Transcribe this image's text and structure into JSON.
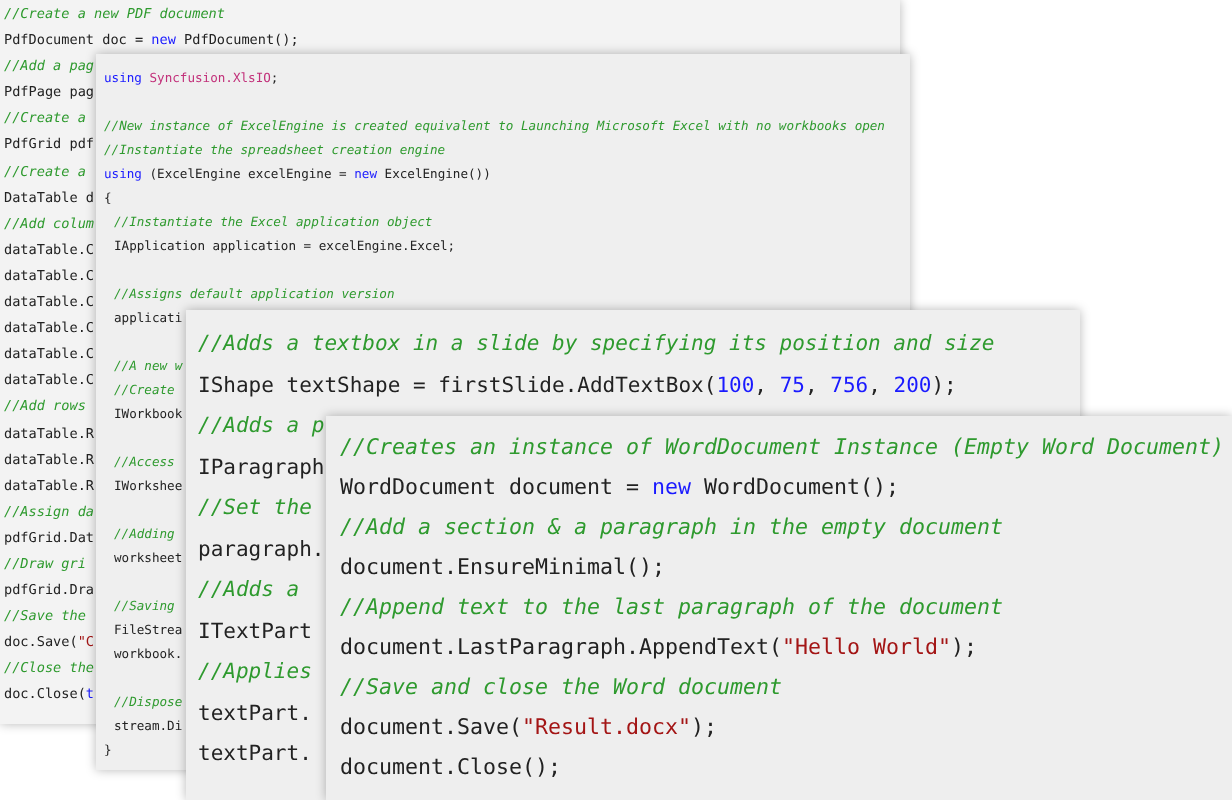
{
  "panels": [
    {
      "lines": [
        {
          "tokens": [
            {
              "text": "//Create a new PDF document",
              "kind": "comment"
            }
          ]
        },
        {
          "tokens": [
            {
              "text": "PdfDocument doc = ",
              "kind": "plain"
            },
            {
              "text": "new",
              "kind": "keyword"
            },
            {
              "text": " PdfDocument();",
              "kind": "plain"
            }
          ]
        },
        {
          "tokens": [
            {
              "text": "//Add a pag",
              "kind": "comment"
            }
          ]
        },
        {
          "tokens": [
            {
              "text": "PdfPage pag",
              "kind": "plain"
            }
          ]
        },
        {
          "tokens": [
            {
              "text": "//Create a",
              "kind": "comment"
            }
          ]
        },
        {
          "tokens": [
            {
              "text": "PdfGrid pdf",
              "kind": "plain"
            }
          ]
        },
        {
          "tokens": [
            {
              "text": "//Create a",
              "kind": "comment"
            }
          ]
        },
        {
          "tokens": [
            {
              "text": "DataTable d",
              "kind": "plain"
            }
          ]
        },
        {
          "tokens": [
            {
              "text": "//Add colum",
              "kind": "comment"
            }
          ]
        },
        {
          "tokens": [
            {
              "text": "dataTable.C",
              "kind": "plain"
            }
          ]
        },
        {
          "tokens": [
            {
              "text": "dataTable.C",
              "kind": "plain"
            }
          ]
        },
        {
          "tokens": [
            {
              "text": "dataTable.C",
              "kind": "plain"
            }
          ]
        },
        {
          "tokens": [
            {
              "text": "dataTable.C",
              "kind": "plain"
            }
          ]
        },
        {
          "tokens": [
            {
              "text": "dataTable.C",
              "kind": "plain"
            }
          ]
        },
        {
          "tokens": [
            {
              "text": "dataTable.C",
              "kind": "plain"
            }
          ]
        },
        {
          "tokens": [
            {
              "text": "//Add rows",
              "kind": "comment"
            }
          ]
        },
        {
          "tokens": [
            {
              "text": "dataTable.R",
              "kind": "plain"
            }
          ]
        },
        {
          "tokens": [
            {
              "text": "dataTable.R",
              "kind": "plain"
            }
          ]
        },
        {
          "tokens": [
            {
              "text": "dataTable.R",
              "kind": "plain"
            }
          ]
        },
        {
          "tokens": [
            {
              "text": "//Assign da",
              "kind": "comment"
            }
          ]
        },
        {
          "tokens": [
            {
              "text": "pdfGrid.Dat",
              "kind": "plain"
            }
          ]
        },
        {
          "tokens": [
            {
              "text": "//Draw gri",
              "kind": "comment"
            }
          ]
        },
        {
          "tokens": [
            {
              "text": "pdfGrid.Dra",
              "kind": "plain"
            }
          ]
        },
        {
          "tokens": [
            {
              "text": "//Save the",
              "kind": "comment"
            }
          ]
        },
        {
          "tokens": [
            {
              "text": "doc.Save(",
              "kind": "plain"
            },
            {
              "text": "\"C",
              "kind": "string"
            }
          ]
        },
        {
          "tokens": [
            {
              "text": "//Close the",
              "kind": "comment"
            }
          ]
        },
        {
          "tokens": [
            {
              "text": "doc.Close(",
              "kind": "plain"
            },
            {
              "text": "t",
              "kind": "keyword"
            }
          ]
        }
      ]
    },
    {
      "lines": [
        {
          "tokens": [
            {
              "text": "using",
              "kind": "keyword"
            },
            {
              "text": " Syncfusion.XlsIO",
              "kind": "namespace"
            },
            {
              "text": ";",
              "kind": "plain"
            }
          ]
        },
        {
          "blank_before": true,
          "tokens": [
            {
              "text": "//New instance of ExcelEngine is created equivalent to Launching Microsoft Excel with no workbooks open",
              "kind": "comment"
            }
          ]
        },
        {
          "tokens": [
            {
              "text": "//Instantiate the spreadsheet creation engine",
              "kind": "comment"
            }
          ]
        },
        {
          "tokens": [
            {
              "text": "using",
              "kind": "keyword"
            },
            {
              "text": " (ExcelEngine excelEngine = ",
              "kind": "plain"
            },
            {
              "text": "new",
              "kind": "keyword"
            },
            {
              "text": " ExcelEngine())",
              "kind": "plain"
            }
          ]
        },
        {
          "tokens": [
            {
              "text": "{",
              "kind": "plain"
            }
          ]
        },
        {
          "indented": true,
          "tokens": [
            {
              "text": "//Instantiate the Excel application object",
              "kind": "comment"
            }
          ]
        },
        {
          "indented": true,
          "tokens": [
            {
              "text": "IApplication application = excelEngine.Excel;",
              "kind": "plain"
            }
          ]
        },
        {
          "indented": true,
          "blank_before": true,
          "tokens": [
            {
              "text": "//Assigns default application version",
              "kind": "comment"
            }
          ]
        },
        {
          "indented": true,
          "tokens": [
            {
              "text": "applicati",
              "kind": "plain"
            }
          ]
        },
        {
          "indented": true,
          "blank_before": true,
          "tokens": [
            {
              "text": "//A new w",
              "kind": "comment"
            }
          ]
        },
        {
          "indented": true,
          "tokens": [
            {
              "text": "//Create",
              "kind": "comment"
            }
          ]
        },
        {
          "indented": true,
          "tokens": [
            {
              "text": "IWorkbook",
              "kind": "plain"
            }
          ]
        },
        {
          "indented": true,
          "blank_before": true,
          "tokens": [
            {
              "text": "//Access",
              "kind": "comment"
            }
          ]
        },
        {
          "indented": true,
          "tokens": [
            {
              "text": "IWorkshee",
              "kind": "plain"
            }
          ]
        },
        {
          "indented": true,
          "blank_before": true,
          "tokens": [
            {
              "text": "//Adding",
              "kind": "comment"
            }
          ]
        },
        {
          "indented": true,
          "tokens": [
            {
              "text": "worksheet",
              "kind": "plain"
            }
          ]
        },
        {
          "indented": true,
          "blank_before": true,
          "tokens": [
            {
              "text": "//Saving",
              "kind": "comment"
            }
          ]
        },
        {
          "indented": true,
          "tokens": [
            {
              "text": "FileStrea",
              "kind": "plain"
            }
          ]
        },
        {
          "indented": true,
          "tokens": [
            {
              "text": "workbook.",
              "kind": "plain"
            }
          ]
        },
        {
          "indented": true,
          "blank_before": true,
          "tokens": [
            {
              "text": "//Dispose",
              "kind": "comment"
            }
          ]
        },
        {
          "indented": true,
          "tokens": [
            {
              "text": "stream.Di",
              "kind": "plain"
            }
          ]
        },
        {
          "tokens": [
            {
              "text": "}",
              "kind": "plain"
            }
          ]
        }
      ]
    },
    {
      "lines": [
        {
          "tokens": [
            {
              "text": "//Adds a textbox in a slide by specifying its position and size",
              "kind": "comment"
            }
          ]
        },
        {
          "tokens": [
            {
              "text": "IShape textShape = firstSlide.AddTextBox(",
              "kind": "plain"
            },
            {
              "text": "100",
              "kind": "number"
            },
            {
              "text": ", ",
              "kind": "plain"
            },
            {
              "text": "75",
              "kind": "number"
            },
            {
              "text": ", ",
              "kind": "plain"
            },
            {
              "text": "756",
              "kind": "number"
            },
            {
              "text": ", ",
              "kind": "plain"
            },
            {
              "text": "200",
              "kind": "number"
            },
            {
              "text": ");",
              "kind": "plain"
            }
          ]
        },
        {
          "tokens": [
            {
              "text": "//Adds a p",
              "kind": "comment"
            }
          ]
        },
        {
          "tokens": [
            {
              "text": "IParagraph",
              "kind": "plain"
            }
          ]
        },
        {
          "tokens": [
            {
              "text": "//Set the",
              "kind": "comment"
            }
          ]
        },
        {
          "tokens": [
            {
              "text": "paragraph.",
              "kind": "plain"
            }
          ]
        },
        {
          "tokens": [
            {
              "text": "//Adds a",
              "kind": "comment"
            }
          ]
        },
        {
          "tokens": [
            {
              "text": "ITextPart",
              "kind": "plain"
            }
          ]
        },
        {
          "tokens": [
            {
              "text": "//Applies",
              "kind": "comment"
            }
          ]
        },
        {
          "tokens": [
            {
              "text": "textPart.",
              "kind": "plain"
            }
          ]
        },
        {
          "tokens": [
            {
              "text": "textPart.",
              "kind": "plain"
            }
          ]
        }
      ]
    },
    {
      "lines": [
        {
          "tokens": [
            {
              "text": "//Creates an instance of WordDocument Instance (Empty Word Document)",
              "kind": "comment"
            }
          ]
        },
        {
          "tokens": [
            {
              "text": "WordDocument document = ",
              "kind": "plain"
            },
            {
              "text": "new",
              "kind": "keyword"
            },
            {
              "text": " WordDocument();",
              "kind": "plain"
            }
          ]
        },
        {
          "tokens": [
            {
              "text": "//Add a section & a paragraph in the empty document",
              "kind": "comment"
            }
          ]
        },
        {
          "tokens": [
            {
              "text": "document.EnsureMinimal();",
              "kind": "plain"
            }
          ]
        },
        {
          "tokens": [
            {
              "text": "//Append text to the last paragraph of the document",
              "kind": "comment"
            }
          ]
        },
        {
          "tokens": [
            {
              "text": "document.LastParagraph.AppendText(",
              "kind": "plain"
            },
            {
              "text": "\"Hello World\"",
              "kind": "string"
            },
            {
              "text": ");",
              "kind": "plain"
            }
          ]
        },
        {
          "tokens": [
            {
              "text": "//Save and close the Word document",
              "kind": "comment"
            }
          ]
        },
        {
          "tokens": [
            {
              "text": "document.Save(",
              "kind": "plain"
            },
            {
              "text": "\"Result.docx\"",
              "kind": "string"
            },
            {
              "text": ");",
              "kind": "plain"
            }
          ]
        },
        {
          "tokens": [
            {
              "text": "document.Close();",
              "kind": "plain"
            }
          ]
        }
      ]
    }
  ]
}
